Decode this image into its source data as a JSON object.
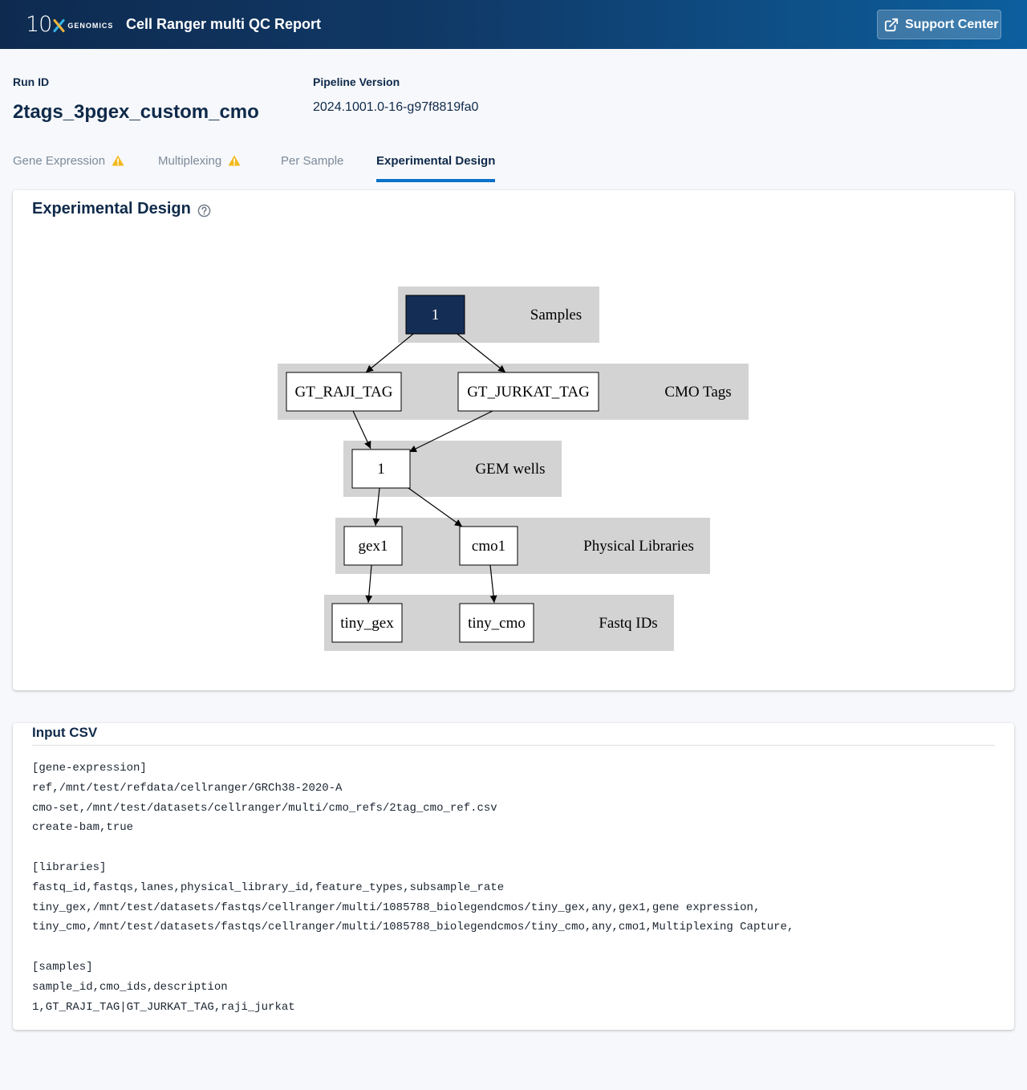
{
  "header": {
    "logo_number": "10",
    "logo_word": "GENOMICS",
    "app_title": "Cell Ranger multi QC Report",
    "support_label": "Support Center"
  },
  "run": {
    "run_id_label": "Run ID",
    "run_id": "2tags_3pgex_custom_cmo",
    "pipeline_label": "Pipeline Version",
    "pipeline_version": "2024.1001.0-16-g97f8819fa0"
  },
  "tabs": [
    {
      "label": "Gene Expression",
      "warning": true,
      "active": false
    },
    {
      "label": "Multiplexing",
      "warning": true,
      "active": false
    },
    {
      "label": "Per Sample",
      "warning": false,
      "active": false
    },
    {
      "label": "Experimental Design",
      "warning": false,
      "active": true
    }
  ],
  "design": {
    "title": "Experimental Design",
    "clusters": {
      "samples": "Samples",
      "cmo_tags": "CMO Tags",
      "gem_wells": "GEM wells",
      "physical_libraries": "Physical Libraries",
      "fastq_ids": "Fastq IDs"
    },
    "nodes": {
      "sample": "1",
      "tag_raji": "GT_RAJI_TAG",
      "tag_jurkat": "GT_JURKAT_TAG",
      "gem_well": "1",
      "lib_gex": "gex1",
      "lib_cmo": "cmo1",
      "fastq_gex": "tiny_gex",
      "fastq_cmo": "tiny_cmo"
    },
    "colors": {
      "cluster_fill": "#d3d3d3",
      "sample_fill": "#142d54"
    }
  },
  "csv": {
    "title": "Input CSV",
    "lines": [
      "[gene-expression]",
      "ref,/mnt/test/refdata/cellranger/GRCh38-2020-A",
      "cmo-set,/mnt/test/datasets/cellranger/multi/cmo_refs/2tag_cmo_ref.csv",
      "create-bam,true",
      "",
      "[libraries]",
      "fastq_id,fastqs,lanes,physical_library_id,feature_types,subsample_rate",
      "tiny_gex,/mnt/test/datasets/fastqs/cellranger/multi/1085788_biolegendcmos/tiny_gex,any,gex1,gene expression,",
      "tiny_cmo,/mnt/test/datasets/fastqs/cellranger/multi/1085788_biolegendcmos/tiny_cmo,any,cmo1,Multiplexing Capture,",
      "",
      "[samples]",
      "sample_id,cmo_ids,description",
      "1,GT_RAJI_TAG|GT_JURKAT_TAG,raji_jurkat"
    ]
  }
}
